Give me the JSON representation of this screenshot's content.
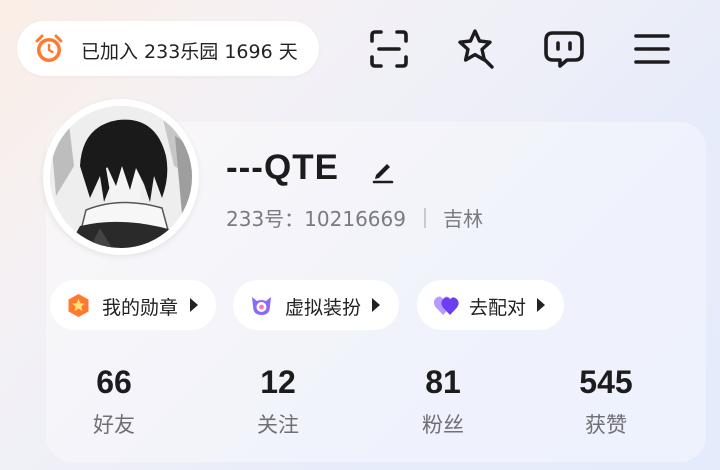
{
  "header": {
    "join_badge": {
      "text": "已加入 233乐园 1696 天",
      "icon": "alarm-clock-icon"
    },
    "icons": [
      "scan-icon",
      "star-favorites-icon",
      "message-icon",
      "menu-icon"
    ]
  },
  "profile": {
    "username": "---QTE",
    "id_text": "233号：10216669",
    "location": "吉林"
  },
  "chips": [
    {
      "label": "我的勋章",
      "icon": "medal-icon"
    },
    {
      "label": "虚拟装扮",
      "icon": "dress-up-icon"
    },
    {
      "label": "去配对",
      "icon": "match-hearts-icon"
    }
  ],
  "stats": [
    {
      "value": "66",
      "label": "好友"
    },
    {
      "value": "12",
      "label": "关注"
    },
    {
      "value": "81",
      "label": "粉丝"
    },
    {
      "value": "545",
      "label": "获赞"
    }
  ],
  "colors": {
    "accent_orange": "#ff7a2e",
    "purple": "#7c5cf6"
  }
}
